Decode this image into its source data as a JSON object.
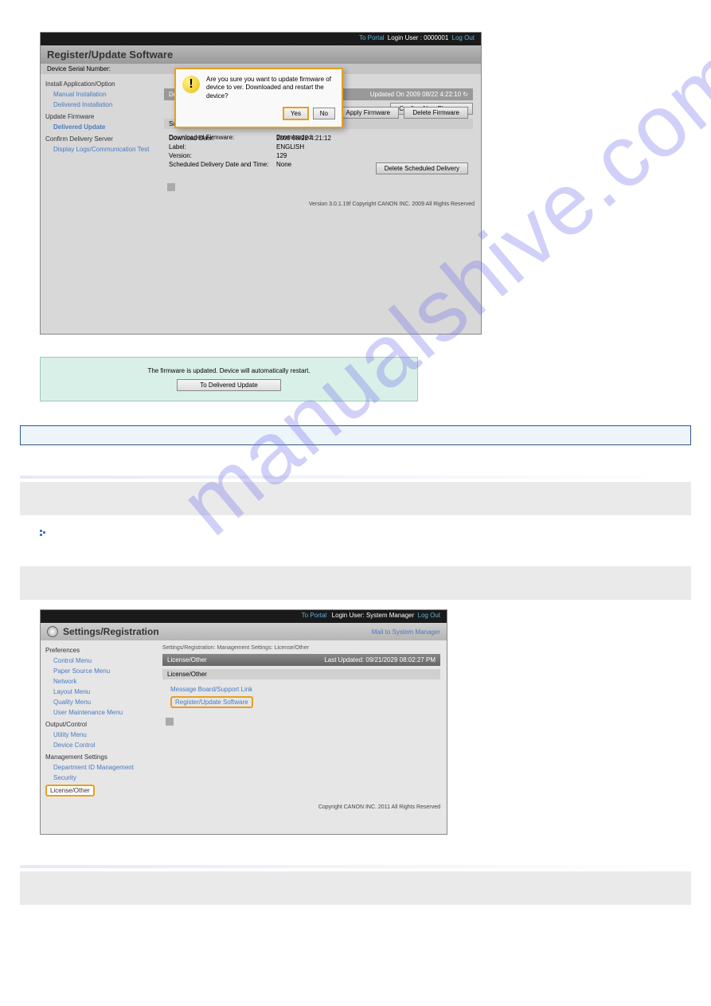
{
  "watermark": "manualshive.com",
  "screenshot1": {
    "topbar": {
      "portal": "To Portal",
      "loginLabel": "Login User",
      "loginUser": "0000001",
      "logout": "Log Out"
    },
    "title": "Register/Update Software",
    "serialLabel": "Device Serial Number:",
    "nav": {
      "install": {
        "header": "Install Application/Option",
        "items": [
          "Manual Installation",
          "Delivered Installation"
        ]
      },
      "update": {
        "header": "Update Firmware",
        "items": [
          "Delivered Update"
        ]
      },
      "confirm": {
        "header": "Confirm Delivery Server",
        "items": [
          "Display Logs/Communication Test"
        ]
      }
    },
    "panel": {
      "deliTitle": "Deli",
      "updated": "Updated On 2009 08/22 4:22:10",
      "confirmNew": "Confirm New Firmware",
      "schedHead": "Sche",
      "rows": {
        "downloadedFirmware": {
          "l": "Downloaded Firmware:",
          "v": "Downloaded"
        },
        "downloadDate": {
          "l": "Download Date:",
          "v": "2009 08/22 4:21:12"
        },
        "label": {
          "l": "Label:",
          "v": "ENGLISH"
        },
        "version": {
          "l": "Version:",
          "v": "129"
        },
        "sched": {
          "l": "Scheduled Delivery Date and Time:",
          "v": "None"
        }
      },
      "buttons": {
        "apply": "Apply Firmware",
        "del": "Delete Firmware",
        "delSched": "Delete Scheduled Delivery"
      }
    },
    "footer": "Version 3.0.1.19f Copyright CANON INC. 2009 All Rights Reserved"
  },
  "modal": {
    "text": "Are you sure you want to update firmware of device to ver. Downloaded and restart the device?",
    "yes": "Yes",
    "no": "No"
  },
  "greenbox": {
    "text": "The firmware is updated. Device will automatically restart.",
    "button": "To Delivered Update"
  },
  "screenshot2": {
    "topbar": {
      "portal": "To Portal",
      "loginLabel": "Login User:",
      "loginUser": "System Manager",
      "logout": "Log Out"
    },
    "title": "Settings/Registration",
    "mail": "Mail to System Manager",
    "nav": {
      "pref": {
        "header": "Preferences",
        "items": [
          "Control Menu",
          "Paper Source Menu",
          "Network",
          "Layout Menu",
          "Quality Menu",
          "User Maintenance Menu"
        ]
      },
      "out": {
        "header": "Output/Control",
        "items": [
          "Utility Menu",
          "Device Control"
        ]
      },
      "mgmt": {
        "header": "Management Settings",
        "items": [
          "Department ID Management",
          "Security",
          "License/Other"
        ]
      }
    },
    "main": {
      "breadcrumb": "Settings/Registration: Management Settings: License/Other",
      "barTitle": "License/Other",
      "lastUpdated": "Last Updated: 09/21/2029 08:02:27 PM",
      "subhead": "License/Other",
      "links": [
        "Message Board/Support Link",
        "Register/Update Software"
      ]
    },
    "copyright": "Copyright CANON INC. 2011 All Rights Reserved"
  }
}
